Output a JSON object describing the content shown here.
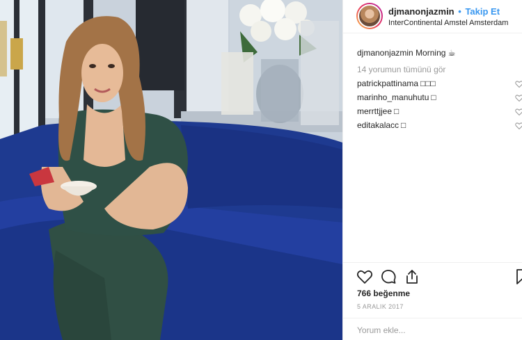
{
  "header": {
    "username": "djmanonjazmin",
    "separator": "•",
    "follow_label": "Takip Et",
    "location": "InterContinental Amstel Amsterdam"
  },
  "caption": {
    "username": "djmanonjazmin",
    "text": "Morning ☕"
  },
  "view_all_comments": "14 yorumun tümünü gör",
  "comments": [
    {
      "username": "patrickpattinama",
      "text": "□□□"
    },
    {
      "username": "marinho_manuhutu",
      "text": "□"
    },
    {
      "username": "merrttjjee",
      "text": "□"
    },
    {
      "username": "editakalacc",
      "text": "□"
    }
  ],
  "actions": {
    "like_icon": "heart-icon",
    "comment_icon": "speech-bubble-icon",
    "share_icon": "share-icon",
    "save_icon": "bookmark-icon"
  },
  "likes": "766 beğenme",
  "date": "5 ARALIK 2017",
  "add_comment": {
    "placeholder": "Yorum ekle..."
  },
  "colors": {
    "link": "#3897f0",
    "text": "#262626",
    "muted": "#999999",
    "border": "#efefef",
    "sofa": "#1f3a8f"
  }
}
